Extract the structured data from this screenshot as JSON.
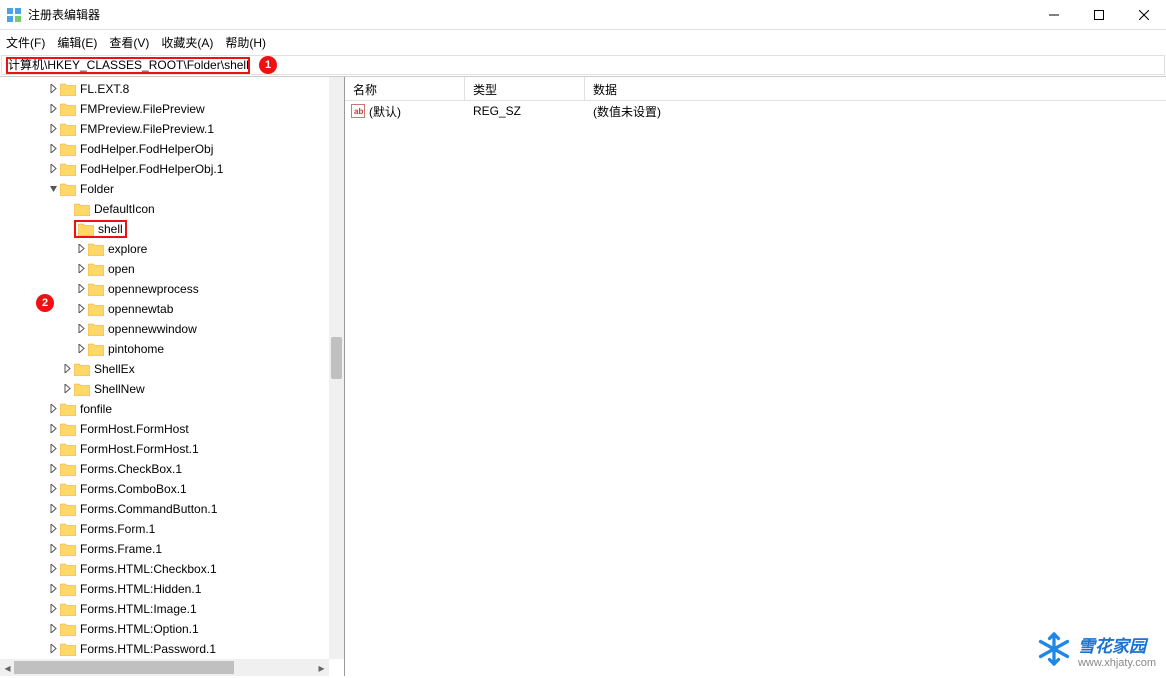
{
  "window": {
    "title": "注册表编辑器"
  },
  "menu": {
    "file": "文件(F)",
    "edit": "编辑(E)",
    "view": "查看(V)",
    "fav": "收藏夹(A)",
    "help": "帮助(H)"
  },
  "address": "计算机\\HKEY_CLASSES_ROOT\\Folder\\shell",
  "callouts": {
    "one": "1",
    "two": "2"
  },
  "tree": {
    "items": [
      {
        "indent": 2,
        "toggle": ">",
        "label": "FL.EXT.8"
      },
      {
        "indent": 2,
        "toggle": ">",
        "label": "FMPreview.FilePreview"
      },
      {
        "indent": 2,
        "toggle": ">",
        "label": "FMPreview.FilePreview.1"
      },
      {
        "indent": 2,
        "toggle": ">",
        "label": "FodHelper.FodHelperObj"
      },
      {
        "indent": 2,
        "toggle": ">",
        "label": "FodHelper.FodHelperObj.1"
      },
      {
        "indent": 2,
        "toggle": "v",
        "label": "Folder"
      },
      {
        "indent": 3,
        "toggle": "",
        "label": "DefaultIcon"
      },
      {
        "indent": 3,
        "toggle": "",
        "label": "shell",
        "highlight": true
      },
      {
        "indent": 4,
        "toggle": ">",
        "label": "explore"
      },
      {
        "indent": 4,
        "toggle": ">",
        "label": "open"
      },
      {
        "indent": 4,
        "toggle": ">",
        "label": "opennewprocess"
      },
      {
        "indent": 4,
        "toggle": ">",
        "label": "opennewtab"
      },
      {
        "indent": 4,
        "toggle": ">",
        "label": "opennewwindow"
      },
      {
        "indent": 4,
        "toggle": ">",
        "label": "pintohome"
      },
      {
        "indent": 3,
        "toggle": ">",
        "label": "ShellEx"
      },
      {
        "indent": 3,
        "toggle": ">",
        "label": "ShellNew"
      },
      {
        "indent": 2,
        "toggle": ">",
        "label": "fonfile"
      },
      {
        "indent": 2,
        "toggle": ">",
        "label": "FormHost.FormHost"
      },
      {
        "indent": 2,
        "toggle": ">",
        "label": "FormHost.FormHost.1"
      },
      {
        "indent": 2,
        "toggle": ">",
        "label": "Forms.CheckBox.1"
      },
      {
        "indent": 2,
        "toggle": ">",
        "label": "Forms.ComboBox.1"
      },
      {
        "indent": 2,
        "toggle": ">",
        "label": "Forms.CommandButton.1"
      },
      {
        "indent": 2,
        "toggle": ">",
        "label": "Forms.Form.1"
      },
      {
        "indent": 2,
        "toggle": ">",
        "label": "Forms.Frame.1"
      },
      {
        "indent": 2,
        "toggle": ">",
        "label": "Forms.HTML:Checkbox.1"
      },
      {
        "indent": 2,
        "toggle": ">",
        "label": "Forms.HTML:Hidden.1"
      },
      {
        "indent": 2,
        "toggle": ">",
        "label": "Forms.HTML:Image.1"
      },
      {
        "indent": 2,
        "toggle": ">",
        "label": "Forms.HTML:Option.1"
      },
      {
        "indent": 2,
        "toggle": ">",
        "label": "Forms.HTML:Password.1"
      }
    ]
  },
  "list": {
    "columns": {
      "name": "名称",
      "type": "类型",
      "data": "数据"
    },
    "rows": [
      {
        "name": "(默认)",
        "type": "REG_SZ",
        "data": "(数值未设置)"
      }
    ]
  },
  "watermark": {
    "main": "雪花家园",
    "sub": "www.xhjaty.com"
  }
}
